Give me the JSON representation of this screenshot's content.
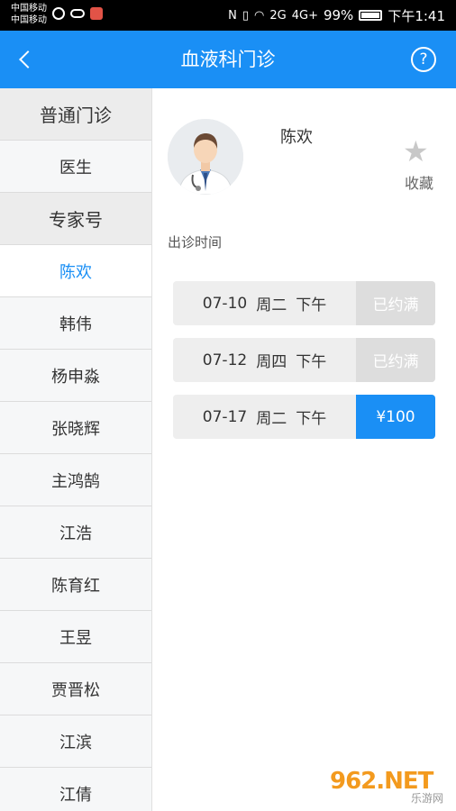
{
  "status_bar": {
    "carrier1": "中国移动",
    "carrier2": "中国移动",
    "signal1": "2G",
    "signal2": "4G+",
    "battery": "99%",
    "time": "下午1:41"
  },
  "header": {
    "title": "血液科门诊",
    "back_icon": "chevron-left-icon",
    "help_icon": "question-circle-icon",
    "help_glyph": "?"
  },
  "sidebar": {
    "items": [
      {
        "label": "普通门诊",
        "type": "category"
      },
      {
        "label": "医生",
        "type": "item"
      },
      {
        "label": "专家号",
        "type": "category"
      },
      {
        "label": "陈欢",
        "type": "item",
        "active": true
      },
      {
        "label": "韩伟",
        "type": "item"
      },
      {
        "label": "杨申淼",
        "type": "item"
      },
      {
        "label": "张晓辉",
        "type": "item"
      },
      {
        "label": "主鸿鹄",
        "type": "item"
      },
      {
        "label": "江浩",
        "type": "item"
      },
      {
        "label": "陈育红",
        "type": "item"
      },
      {
        "label": "王昱",
        "type": "item"
      },
      {
        "label": "贾晋松",
        "type": "item"
      },
      {
        "label": "江滨",
        "type": "item"
      },
      {
        "label": "江倩",
        "type": "item"
      }
    ]
  },
  "doctor": {
    "name": "陈欢",
    "favorite_label": "收藏",
    "favorite_glyph": "★"
  },
  "schedule": {
    "section_label": "出诊时间",
    "slots": [
      {
        "date": "07-10",
        "weekday": "周二",
        "period": "下午",
        "action": "已约满",
        "available": false
      },
      {
        "date": "07-12",
        "weekday": "周四",
        "period": "下午",
        "action": "已约满",
        "available": false
      },
      {
        "date": "07-17",
        "weekday": "周二",
        "period": "下午",
        "action": "¥100",
        "available": true
      }
    ]
  },
  "watermark": {
    "main": "962.NET",
    "sub": "乐游网"
  },
  "colors": {
    "accent": "#1a8ff5",
    "sidebar_bg": "#f6f7f8",
    "full_bg": "#dddddd"
  }
}
